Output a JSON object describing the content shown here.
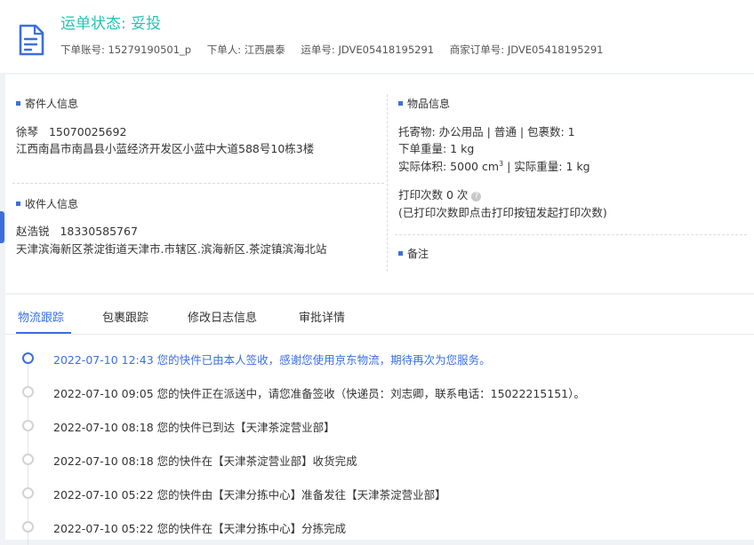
{
  "header": {
    "status_label": "运单状态: ",
    "status_value": "妥投",
    "account_label": "下单账号:",
    "account_value": "15279190501_p",
    "orderer_label": "下单人:",
    "orderer_value": "江西晨泰",
    "waybill_label": "运单号:",
    "waybill_value": "JDVE05418195291",
    "merchant_order_label": "商家订单号:",
    "merchant_order_value": "JDVE05418195291"
  },
  "sender": {
    "title": "寄件人信息",
    "name": "徐琴",
    "phone": "15070025692",
    "address": "江西南昌市南昌县小蓝经济开发区小蓝中大道588号10栋3楼"
  },
  "receiver": {
    "title": "收件人信息",
    "name": "赵浩锐",
    "phone": "18330585767",
    "address": "天津滨海新区茶淀街道天津市.市辖区.滨海新区.茶淀镇滨海北站"
  },
  "goods": {
    "title": "物品信息",
    "line1": "托寄物:  办公用品 | 普通  |  包裹数:  1",
    "line2": "下单重量:   1 kg",
    "volume_label": "实际体积:   5000 cm",
    "volume_sup": "3",
    "volume_rest": " |  实际重量:   1 kg",
    "print_count": "打印次数   0 次",
    "print_note": "(已打印次数即点击打印按钮发起打印次数)",
    "help_glyph": "?"
  },
  "remark": {
    "title": "备注"
  },
  "tabs": [
    {
      "label": "物流跟踪",
      "active": true
    },
    {
      "label": "包裹跟踪",
      "active": false
    },
    {
      "label": "修改日志信息",
      "active": false
    },
    {
      "label": "审批详情",
      "active": false
    }
  ],
  "timeline": [
    {
      "time": "2022-07-10 12:43",
      "text": "您的快件已由本人签收，感谢您使用京东物流，期待再次为您服务。",
      "active": true
    },
    {
      "time": "2022-07-10 09:05",
      "text": "您的快件正在派送中，请您准备签收（快递员：刘志卿，联系电话：15022215151）。",
      "active": false
    },
    {
      "time": "2022-07-10 08:18",
      "text": "您的快件已到达【天津茶淀营业部】",
      "active": false
    },
    {
      "time": "2022-07-10 08:18",
      "text": "您的快件在【天津茶淀营业部】收货完成",
      "active": false
    },
    {
      "time": "2022-07-10 05:22",
      "text": "您的快件由【天津分拣中心】准备发往【天津茶淀营业部】",
      "active": false
    },
    {
      "time": "2022-07-10 05:22",
      "text": "您的快件在【天津分拣中心】分拣完成",
      "active": false
    }
  ],
  "colors": {
    "accent": "#3b6fe0",
    "status": "#27c2b6"
  }
}
